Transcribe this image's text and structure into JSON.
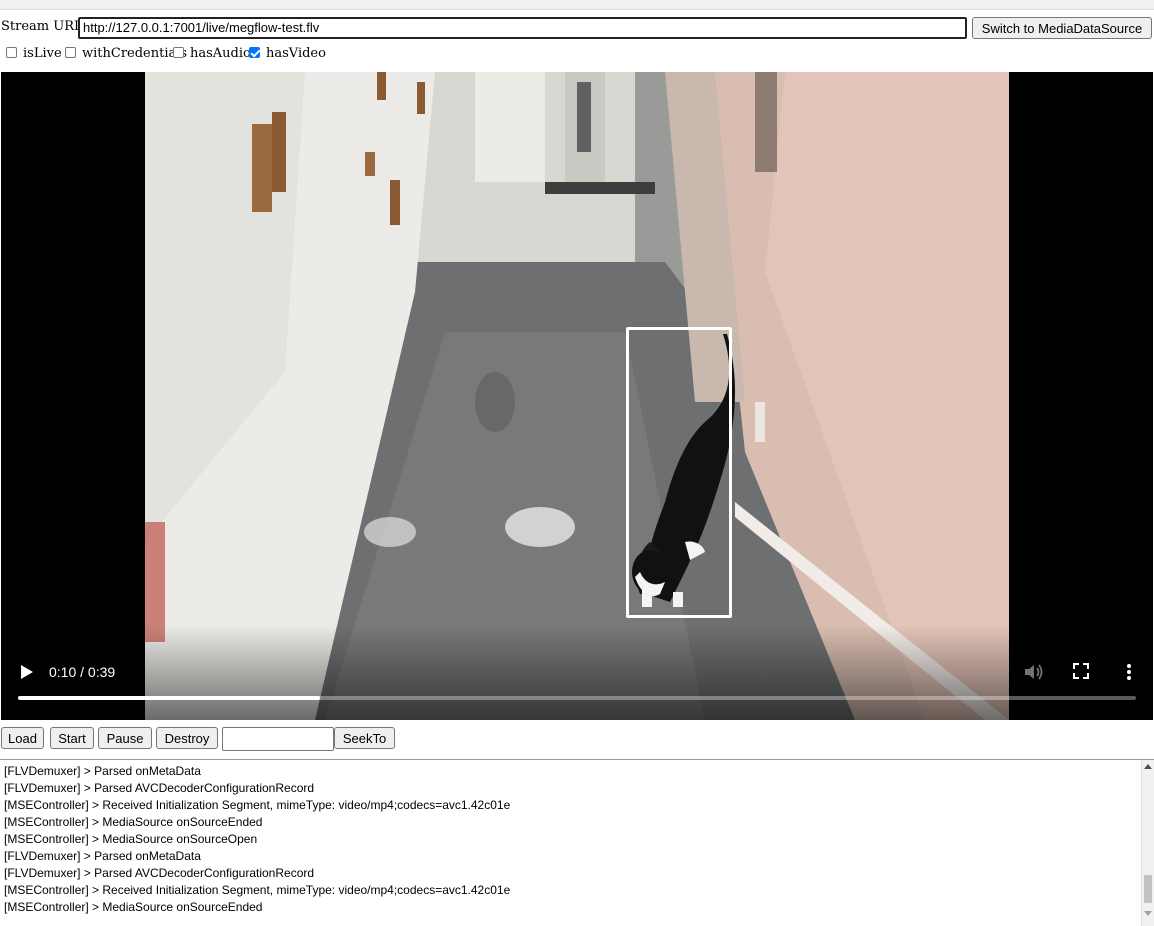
{
  "url_row": {
    "label": "Stream URL:",
    "url_value": "http://127.0.0.1:7001/live/megflow-test.flv",
    "switch_label": "Switch to MediaDataSource"
  },
  "options": [
    {
      "label": "isLive",
      "checked": false
    },
    {
      "label": "withCredentials",
      "checked": false
    },
    {
      "label": "hasAudio",
      "checked": false
    },
    {
      "label": "hasVideo",
      "checked": true
    }
  ],
  "video": {
    "time_text": "0:10 / 0:39",
    "progress_fraction": 0.27,
    "icons": [
      "play-icon",
      "volume-icon",
      "fullscreen-icon",
      "more-options-icon"
    ]
  },
  "controls": {
    "load": "Load",
    "start": "Start",
    "pause": "Pause",
    "destroy": "Destroy",
    "seek_value": "",
    "seekto": "SeekTo"
  },
  "log": {
    "lines": [
      "[FLVDemuxer] > Parsed onMetaData",
      "[FLVDemuxer] > Parsed AVCDecoderConfigurationRecord",
      "[MSEController] > Received Initialization Segment, mimeType: video/mp4;codecs=avc1.42c01e",
      "[MSEController] > MediaSource onSourceEnded",
      "[MSEController] > MediaSource onSourceOpen",
      "[FLVDemuxer] > Parsed onMetaData",
      "[FLVDemuxer] > Parsed AVCDecoderConfigurationRecord",
      "[MSEController] > Received Initialization Segment, mimeType: video/mp4;codecs=avc1.42c01e",
      "[MSEController] > MediaSource onSourceEnded"
    ]
  },
  "colors": {
    "checkbox_accent": "#0075ff",
    "detection_box": "#ffffff"
  }
}
